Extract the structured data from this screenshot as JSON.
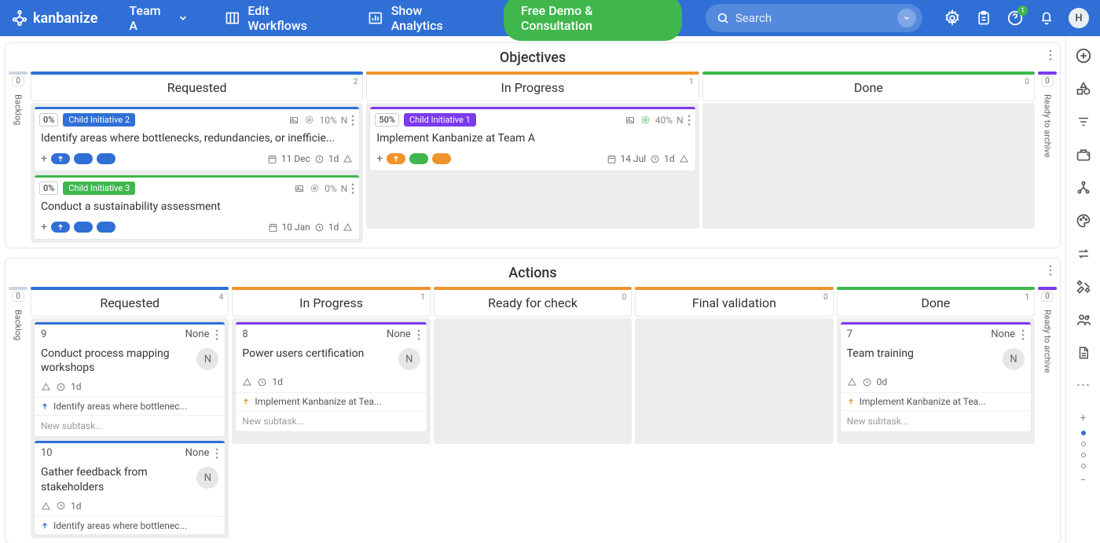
{
  "brand": "kanbanize",
  "team": "Team A",
  "nav": {
    "edit": "Edit Workflows",
    "analytics": "Show Analytics",
    "demo": "Free Demo & Consultation"
  },
  "search": {
    "placeholder": "Search"
  },
  "help_badge": "1",
  "user_initial": "H",
  "colors": {
    "blue": "#2f6fd6",
    "orange": "#f0932b",
    "green": "#3fb74d",
    "purple": "#7c3aed",
    "grey": "#cbd5e1"
  },
  "lanes": [
    {
      "title": "Objectives",
      "edges": {
        "left": {
          "count": "0",
          "label": "Backlog",
          "top": "grey"
        },
        "right": {
          "count": "0",
          "label": "Ready to archive",
          "top": "purple"
        }
      },
      "columns": [
        {
          "name": "Requested",
          "count": "2",
          "bar": "blue",
          "cards": [
            {
              "top": "blue",
              "pct": "0%",
              "tag": "Child Initiative 2",
              "tagc": "blue",
              "title": "Identify areas where bottlenecks, redundancies, or inefficie...",
              "progress": "10%",
              "owner": "N",
              "chips": [
                {
                  "t": "ar",
                  "c": "blue"
                },
                {
                  "c": "blue"
                },
                {
                  "c": "blue"
                }
              ],
              "date": "11 Dec",
              "dur": "1d",
              "eye": "grey"
            },
            {
              "top": "green",
              "pct": "0%",
              "tag": "Child Initiative 3",
              "tagc": "green",
              "title": "Conduct a sustainability assessment",
              "progress": "0%",
              "owner": "N",
              "chips": [
                {
                  "t": "ar",
                  "c": "blue"
                },
                {
                  "c": "blue"
                },
                {
                  "c": "blue"
                }
              ],
              "date": "10 Jan",
              "dur": "1d",
              "eye": "grey"
            }
          ]
        },
        {
          "name": "In Progress",
          "count": "1",
          "bar": "orange",
          "cards": [
            {
              "top": "purple",
              "pct": "50%",
              "tag": "Child Initiative 1",
              "tagc": "purple",
              "title": "Implement Kanbanize at Team A",
              "progress": "40%",
              "owner": "N",
              "chips": [
                {
                  "t": "ar",
                  "c": "orange"
                },
                {
                  "c": "green"
                },
                {
                  "c": "orange"
                }
              ],
              "date": "14 Jul",
              "dur": "1d",
              "eye": "green"
            }
          ]
        },
        {
          "name": "Done",
          "count": "0",
          "bar": "green",
          "cards": []
        }
      ]
    },
    {
      "title": "Actions",
      "edges": {
        "left": {
          "count": "0",
          "label": "Backlog",
          "top": "grey"
        },
        "right": {
          "count": "0",
          "label": "Ready to archive",
          "top": "purple"
        }
      },
      "columns": [
        {
          "name": "Requested",
          "count": "4",
          "bar": "blue",
          "cards": [
            {
              "type": "a",
              "top": "blue",
              "id": "9",
              "assignee": "None",
              "title": "Conduct process mapping workshops",
              "ownN": "N",
              "dur": "1d",
              "parent": "Identify areas where bottlenec...",
              "pc": "blue",
              "sub": "New subtask..."
            },
            {
              "type": "a",
              "top": "blue",
              "id": "10",
              "assignee": "None",
              "title": "Gather feedback from stakeholders",
              "ownN": "N",
              "dur": "1d",
              "parent": "Identify areas where bottlenec...",
              "pc": "blue"
            }
          ]
        },
        {
          "name": "In Progress",
          "count": "1",
          "bar": "orange",
          "cards": [
            {
              "type": "a",
              "top": "purple",
              "id": "8",
              "assignee": "None",
              "title": "Power users certification",
              "ownN": "N",
              "dur": "1d",
              "parent": "Implement Kanbanize at Tea...",
              "pc": "orange",
              "sub": "New subtask..."
            }
          ]
        },
        {
          "name": "Ready for check",
          "count": "0",
          "bar": "orange",
          "cards": []
        },
        {
          "name": "Final validation",
          "count": "0",
          "bar": "orange",
          "cards": []
        },
        {
          "name": "Done",
          "count": "1",
          "bar": "green",
          "cards": [
            {
              "type": "a",
              "top": "purple",
              "id": "7",
              "assignee": "None",
              "title": "Team training",
              "ownN": "N",
              "dur": "0d",
              "parent": "Implement Kanbanize at Tea...",
              "pc": "orange",
              "sub": "New subtask..."
            }
          ]
        }
      ]
    }
  ]
}
